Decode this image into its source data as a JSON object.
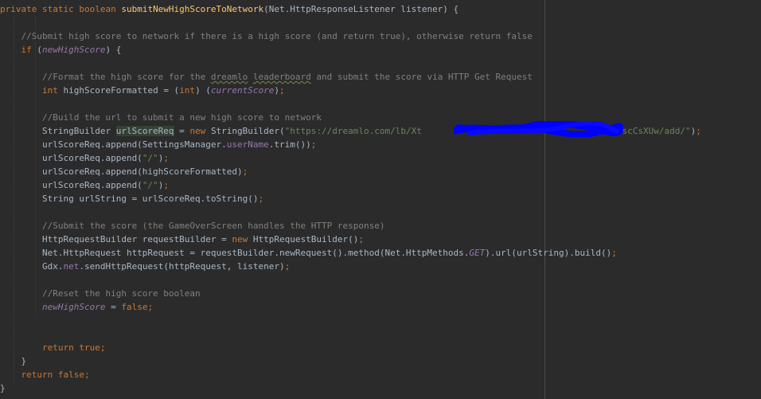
{
  "editor": {
    "lines": [
      [
        {
          "t": "private static boolean ",
          "c": "keyword"
        },
        {
          "t": "submitNewHighScoreToNetwork",
          "c": "method"
        },
        {
          "t": "(Net.HttpResponseListener listener) {",
          "c": "plain"
        }
      ],
      [],
      [
        {
          "t": "    //Submit high score to network if there is a high score (and return true), otherwise return false",
          "c": "comment"
        }
      ],
      [
        {
          "t": "    if ",
          "c": "keyword"
        },
        {
          "t": "(",
          "c": "plain"
        },
        {
          "t": "newHighScore",
          "c": "field"
        },
        {
          "t": ") {",
          "c": "plain"
        }
      ],
      [],
      [
        {
          "t": "        //Format the high score for the ",
          "c": "comment"
        },
        {
          "t": "dreamlo",
          "c": "comment typo"
        },
        {
          "t": " ",
          "c": "comment"
        },
        {
          "t": "leaderboard",
          "c": "comment typo"
        },
        {
          "t": " and submit the score via HTTP Get Request",
          "c": "comment"
        }
      ],
      [
        {
          "t": "        int ",
          "c": "keyword"
        },
        {
          "t": "highScoreFormatted = (",
          "c": "plain"
        },
        {
          "t": "int",
          "c": "keyword"
        },
        {
          "t": ") (",
          "c": "plain"
        },
        {
          "t": "currentScore",
          "c": "field"
        },
        {
          "t": ")",
          "c": "plain"
        },
        {
          "t": ";",
          "c": "keyword"
        }
      ],
      [],
      [
        {
          "t": "        //Build the url to submit a new high score to network",
          "c": "comment"
        }
      ],
      [
        {
          "t": "        StringBuilder ",
          "c": "plain"
        },
        {
          "t": "urlScoreReq",
          "c": "highlight"
        },
        {
          "t": " = ",
          "c": "plain"
        },
        {
          "t": "new ",
          "c": "keyword"
        },
        {
          "t": "StringBuilder(",
          "c": "plain"
        },
        {
          "t": "\"https://dreamlo.com/lb/Xt",
          "c": "string"
        },
        {
          "t": "                                ",
          "c": "plain"
        },
        {
          "t": "rqIcuUscCsXUw/add/\"",
          "c": "string"
        },
        {
          "t": ")",
          "c": "plain"
        },
        {
          "t": ";",
          "c": "keyword"
        }
      ],
      [
        {
          "t": "        urlScoreReq.append(SettingsManager.",
          "c": "plain"
        },
        {
          "t": "userName",
          "c": "field-plain"
        },
        {
          "t": ".trim())",
          "c": "plain"
        },
        {
          "t": ";",
          "c": "keyword"
        }
      ],
      [
        {
          "t": "        urlScoreReq.append(",
          "c": "plain"
        },
        {
          "t": "\"/\"",
          "c": "string"
        },
        {
          "t": ")",
          "c": "plain"
        },
        {
          "t": ";",
          "c": "keyword"
        }
      ],
      [
        {
          "t": "        urlScoreReq.append(highScoreFormatted)",
          "c": "plain"
        },
        {
          "t": ";",
          "c": "keyword"
        }
      ],
      [
        {
          "t": "        urlScoreReq.append(",
          "c": "plain"
        },
        {
          "t": "\"/\"",
          "c": "string"
        },
        {
          "t": ")",
          "c": "plain"
        },
        {
          "t": ";",
          "c": "keyword"
        }
      ],
      [
        {
          "t": "        String urlString = urlScoreReq.toString()",
          "c": "plain"
        },
        {
          "t": ";",
          "c": "keyword"
        }
      ],
      [],
      [
        {
          "t": "        //Submit the score (the GameOverScreen handles the HTTP response)",
          "c": "comment"
        }
      ],
      [
        {
          "t": "        HttpRequestBuilder requestBuilder = ",
          "c": "plain"
        },
        {
          "t": "new ",
          "c": "keyword"
        },
        {
          "t": "HttpRequestBuilder()",
          "c": "plain"
        },
        {
          "t": ";",
          "c": "keyword"
        }
      ],
      [
        {
          "t": "        Net.HttpRequest httpRequest = requestBuilder.newRequest().method(Net.HttpMethods.",
          "c": "plain"
        },
        {
          "t": "GET",
          "c": "field"
        },
        {
          "t": ").url(urlString).build()",
          "c": "plain"
        },
        {
          "t": ";",
          "c": "keyword"
        }
      ],
      [
        {
          "t": "        Gdx.",
          "c": "plain"
        },
        {
          "t": "net",
          "c": "field-plain"
        },
        {
          "t": ".sendHttpRequest(httpRequest, listener)",
          "c": "plain"
        },
        {
          "t": ";",
          "c": "keyword"
        }
      ],
      [],
      [
        {
          "t": "        //Reset the high score boolean",
          "c": "comment"
        }
      ],
      [
        {
          "t": "        ",
          "c": "plain"
        },
        {
          "t": "newHighScore",
          "c": "field"
        },
        {
          "t": " = ",
          "c": "plain"
        },
        {
          "t": "false;",
          "c": "keyword"
        }
      ],
      [],
      [],
      [
        {
          "t": "        return true;",
          "c": "keyword"
        }
      ],
      [
        {
          "t": "    }",
          "c": "plain"
        }
      ],
      [
        {
          "t": "    return false;",
          "c": "keyword"
        }
      ],
      [
        {
          "t": "}",
          "c": "plain"
        }
      ]
    ]
  },
  "colors": {
    "background": "#2b2b2b",
    "keyword": "#cc7832",
    "method": "#ffc66d",
    "comment": "#808080",
    "string": "#6a8759",
    "field": "#9876aa",
    "plain": "#a9b7c6",
    "redaction": "#0000ff"
  }
}
